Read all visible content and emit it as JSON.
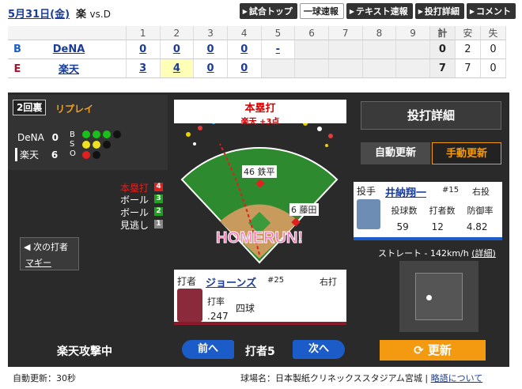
{
  "header": {
    "date": "5月31日(金)",
    "team_home": "楽",
    "vs": "vs.",
    "team_away": "D",
    "tabs": [
      "試合トップ",
      "一球速報",
      "テキスト速報",
      "投打詳細",
      "コメント"
    ]
  },
  "scoreboard": {
    "innings": [
      "1",
      "2",
      "3",
      "4",
      "5",
      "6",
      "7",
      "8",
      "9"
    ],
    "total_label": "計",
    "hits_label": "安",
    "errors_label": "失",
    "rows": [
      {
        "name": "DeNA",
        "logo": "B",
        "innings": [
          "0",
          "0",
          "0",
          "0",
          "-",
          "",
          "",
          "",
          ""
        ],
        "r": "0",
        "h": "2",
        "e": "0"
      },
      {
        "name": "楽天",
        "logo": "E",
        "innings": [
          "3",
          "4",
          "0",
          "0",
          "",
          "",
          "",
          "",
          ""
        ],
        "r": "7",
        "h": "7",
        "e": "0"
      }
    ]
  },
  "state": {
    "inning": "2回裏",
    "replay": "リプレイ",
    "score_lines": [
      {
        "team": "DeNA",
        "score": "0"
      },
      {
        "team": "楽天",
        "score": "6"
      }
    ],
    "bso": [
      "B",
      "S",
      "O"
    ],
    "results": [
      {
        "label": "本塁打",
        "num": "4",
        "color": "#e02020"
      },
      {
        "label": "ボール",
        "num": "3",
        "color": "#1fa31f"
      },
      {
        "label": "ボール",
        "num": "2",
        "color": "#1fa31f"
      },
      {
        "label": "見逃し",
        "num": "1",
        "color": "#888888"
      }
    ],
    "next_batter_label": "◀ 次の打者",
    "next_batter": "マギー"
  },
  "play": {
    "result": "本塁打",
    "detail": "楽天 +3点",
    "homerun_text": "HOMERUN!",
    "fielder_cf": "46 鉄平",
    "fielder_3b": "6 藤田"
  },
  "pitcher": {
    "role": "投手",
    "name": "井納翔一",
    "number": "#15",
    "hand": "右投",
    "stat_labels": [
      "投球数",
      "打者数",
      "防御率"
    ],
    "stat_values": [
      "59",
      "12",
      "4.82"
    ]
  },
  "batter": {
    "role": "打者",
    "name": "ジョーンズ",
    "number": "#25",
    "hand": "右打",
    "avg_label": "打率",
    "avg": ".247",
    "result": "四球"
  },
  "controls": {
    "detail_button": "投打詳細",
    "auto_update": "自動更新",
    "manual_update": "手動更新",
    "pitch_info": "ストレート - 142km/h",
    "pitch_detail_link": "(詳細)"
  },
  "bottom": {
    "attack": "楽天攻撃中",
    "prev": "前へ",
    "batter_no": "打者5",
    "next": "次へ",
    "refresh": "更新"
  },
  "footer": {
    "auto_interval": "自動更新：30秒",
    "stadium_label": "球場名：日本製紙クリネックススタジアム宮城",
    "abbr_link": "略語について"
  },
  "colors": {
    "accent": "#f39a10",
    "link": "#1a3c96",
    "panel": "#2a2a2a"
  }
}
